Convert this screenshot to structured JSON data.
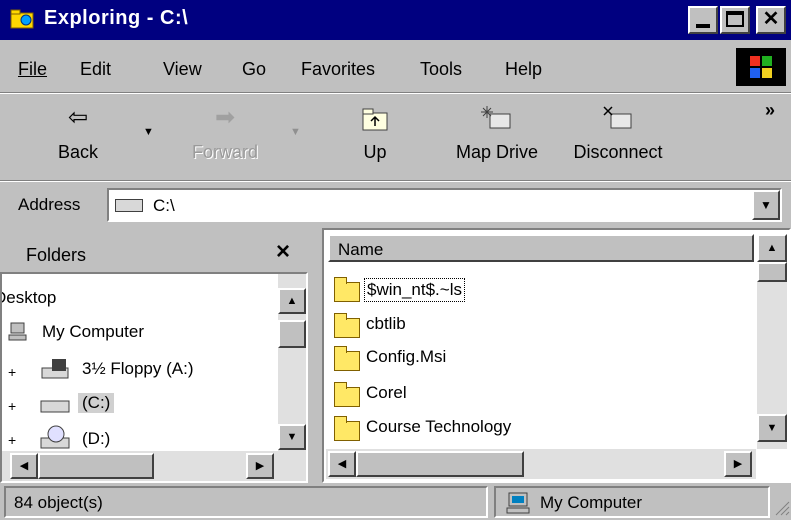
{
  "window": {
    "title": "Exploring - C:\\"
  },
  "menu": [
    "File",
    "Edit",
    "View",
    "Go",
    "Favorites",
    "Tools",
    "Help"
  ],
  "toolbar": {
    "back": "Back",
    "forward": "Forward",
    "up": "Up",
    "map_drive": "Map Drive",
    "disconnect": "Disconnect",
    "more": "»"
  },
  "address": {
    "label": "Address",
    "value": "C:\\"
  },
  "folders_pane": {
    "title": "Folders",
    "close": "×",
    "items": [
      "Desktop",
      "My Computer",
      "3½ Floppy (A:)",
      "(C:)",
      "(D:)"
    ]
  },
  "list_pane": {
    "column_name": "Name",
    "items": [
      "$win_nt$.~ls",
      "cbtlib",
      "Config.Msi",
      "Corel",
      "Course Technology"
    ]
  },
  "status": {
    "objects": "84 object(s)",
    "location": "My Computer"
  }
}
